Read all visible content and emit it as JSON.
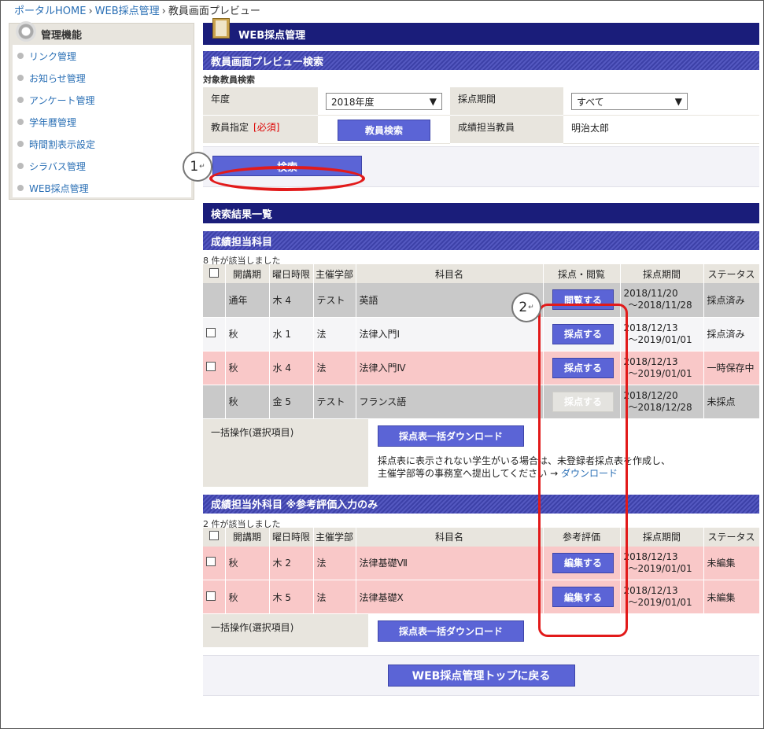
{
  "breadcrumb": {
    "home": "ポータルHOME",
    "parent": "WEB採点管理",
    "current": "教員画面プレビュー",
    "sep": "›"
  },
  "sidebar": {
    "title": "管理機能",
    "items": [
      {
        "label": "リンク管理"
      },
      {
        "label": "お知らせ管理"
      },
      {
        "label": "アンケート管理"
      },
      {
        "label": "学年暦管理"
      },
      {
        "label": "時間割表示設定"
      },
      {
        "label": "シラバス管理"
      },
      {
        "label": "WEB採点管理"
      }
    ]
  },
  "main": {
    "title": "WEB採点管理",
    "search_section": "教員画面プレビュー検索",
    "search_label": "対象教員検索",
    "year_label": "年度",
    "year_value": "2018年度",
    "period_label": "採点期間",
    "period_value": "すべて",
    "teacher_label": "教員指定",
    "required": "[必須]",
    "teacher_search_button": "教員検索",
    "grade_teacher_label": "成績担当教員",
    "grade_teacher_value": "明治太郎",
    "search_button": "検索",
    "results_title": "検索結果一覧",
    "assigned": {
      "title": "成績担当科目",
      "count": "8 件が該当しました",
      "headers": [
        "開講期",
        "曜日時限",
        "主催学部",
        "科目名",
        "採点・閲覧",
        "採点期間",
        "ステータス"
      ],
      "rows": [
        {
          "term": "通年",
          "slot": "木 4",
          "dept": "テスト",
          "subject": "英語",
          "action": "閲覧する",
          "period1": "2018/11/20",
          "period2": "～2018/11/28",
          "status": "採点済み"
        },
        {
          "term": "秋",
          "slot": "水 1",
          "dept": "法",
          "subject": "法律入門Ⅰ",
          "action": "採点する",
          "period1": "2018/12/13",
          "period2": "～2019/01/01",
          "status": "採点済み"
        },
        {
          "term": "秋",
          "slot": "水 4",
          "dept": "法",
          "subject": "法律入門Ⅳ",
          "action": "採点する",
          "period1": "2018/12/13",
          "period2": "～2019/01/01",
          "status": "一時保存中"
        },
        {
          "term": "秋",
          "slot": "金 5",
          "dept": "テスト",
          "subject": "フランス語",
          "action": "採点する",
          "period1": "2018/12/20",
          "period2": "～2018/12/28",
          "status": "未採点"
        }
      ],
      "bulk_label": "一括操作(選択項目)",
      "bulk_button": "採点表一括ダウンロード",
      "note_line1": "採点表に表示されない学生がいる場合は、未登録者採点表を作成し、",
      "note_line2": "主催学部等の事務室へ提出してください →",
      "note_link": "ダウンロード"
    },
    "other": {
      "title": "成績担当外科目 ※参考評価入力のみ",
      "count": "2 件が該当しました",
      "headers": [
        "開講期",
        "曜日時限",
        "主催学部",
        "科目名",
        "参考評価",
        "採点期間",
        "ステータス"
      ],
      "rows": [
        {
          "term": "秋",
          "slot": "木 2",
          "dept": "法",
          "subject": "法律基礎Ⅶ",
          "action": "編集する",
          "period1": "2018/12/13",
          "period2": "～2019/01/01",
          "status": "未編集"
        },
        {
          "term": "秋",
          "slot": "木 5",
          "dept": "法",
          "subject": "法律基礎Ⅹ",
          "action": "編集する",
          "period1": "2018/12/13",
          "period2": "～2019/01/01",
          "status": "未編集"
        }
      ],
      "bulk_label": "一括操作(選択項目)",
      "bulk_button": "採点表一括ダウンロード"
    },
    "back_button": "WEB採点管理トップに戻る"
  },
  "annotations": {
    "marker1": "1",
    "marker2": "2",
    "return_mark": "↵"
  },
  "colors": {
    "navy": "#1a1d7a",
    "button": "#5b64d6",
    "highlight": "#e21a1a",
    "pink_row": "#f9c8c8"
  }
}
